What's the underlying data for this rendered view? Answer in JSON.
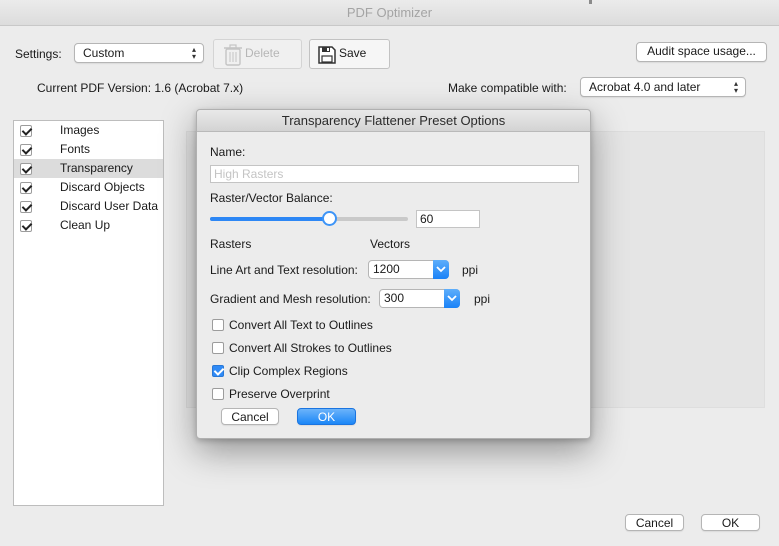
{
  "window": {
    "title": "PDF Optimizer"
  },
  "toolbar": {
    "settings_label": "Settings:",
    "settings_value": "Custom",
    "delete_label": "Delete",
    "save_label": "Save",
    "audit_label": "Audit space usage..."
  },
  "info": {
    "current_version": "Current PDF Version: 1.6 (Acrobat 7.x)",
    "compat_label": "Make compatible with:",
    "compat_value": "Acrobat 4.0 and later"
  },
  "sidebar": {
    "items": [
      {
        "label": "Images",
        "checked": true,
        "selected": false
      },
      {
        "label": "Fonts",
        "checked": true,
        "selected": false
      },
      {
        "label": "Transparency",
        "checked": true,
        "selected": true
      },
      {
        "label": "Discard Objects",
        "checked": true,
        "selected": false
      },
      {
        "label": "Discard User Data",
        "checked": true,
        "selected": false
      },
      {
        "label": "Clean Up",
        "checked": true,
        "selected": false
      }
    ]
  },
  "footer": {
    "cancel_label": "Cancel",
    "ok_label": "OK"
  },
  "dialog": {
    "title": "Transparency Flattener Preset Options",
    "name_label": "Name:",
    "name_placeholder": "High Rasters",
    "balance_label": "Raster/Vector Balance:",
    "balance_value": "60",
    "balance_level": 60,
    "rasters_label": "Rasters",
    "vectors_label": "Vectors",
    "line_art_label": "Line Art and Text resolution:",
    "line_art_value": "1200",
    "gradient_label": "Gradient and Mesh resolution:",
    "gradient_value": "300",
    "ppi": "ppi",
    "options": [
      {
        "label": "Convert All Text to Outlines",
        "checked": false
      },
      {
        "label": "Convert All Strokes to Outlines",
        "checked": false
      },
      {
        "label": "Clip Complex Regions",
        "checked": true
      },
      {
        "label": "Preserve Overprint",
        "checked": false
      }
    ],
    "cancel_label": "Cancel",
    "ok_label": "OK"
  },
  "colors": {
    "accent": "#2d87f5",
    "selection": "#dcdcdc"
  }
}
